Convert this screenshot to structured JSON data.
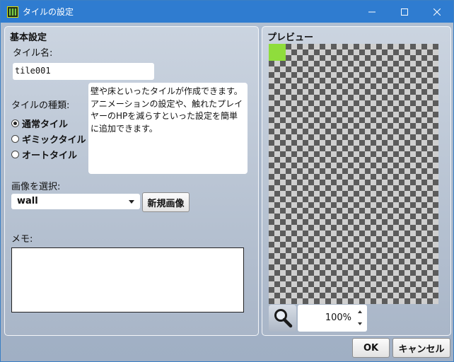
{
  "window": {
    "title": "タイルの設定"
  },
  "basic": {
    "section_title": "基本設定",
    "tile_name_label": "タイル名:",
    "tile_name_value": "tile001",
    "tile_type_label": "タイルの種類:",
    "tile_types": [
      {
        "label": "通常タイル",
        "selected": true
      },
      {
        "label": "ギミックタイル",
        "selected": false
      },
      {
        "label": "オートタイル",
        "selected": false
      }
    ],
    "description": "壁や床といったタイルが作成できます。\nアニメーションの設定や、触れたプレイヤーのHPを減らすといった設定を簡単に追加できます。",
    "image_label": "画像を選択:",
    "image_selected": "wall",
    "new_image_button": "新規画像",
    "memo_label": "メモ:",
    "memo_value": ""
  },
  "preview": {
    "section_title": "プレビュー",
    "tile_color": "#8fdd3c",
    "zoom_value": "100%"
  },
  "footer": {
    "ok_label": "OK",
    "cancel_label": "キャンセル"
  },
  "colors": {
    "titlebar": "#2f7cd0",
    "checker_dark": "#5c5c5c",
    "checker_light": "#cfcfcf"
  },
  "icons": {
    "app": "app-tile-icon",
    "minimize": "minimize-icon",
    "maximize": "maximize-icon",
    "close": "close-icon",
    "zoom": "magnifier-icon"
  }
}
